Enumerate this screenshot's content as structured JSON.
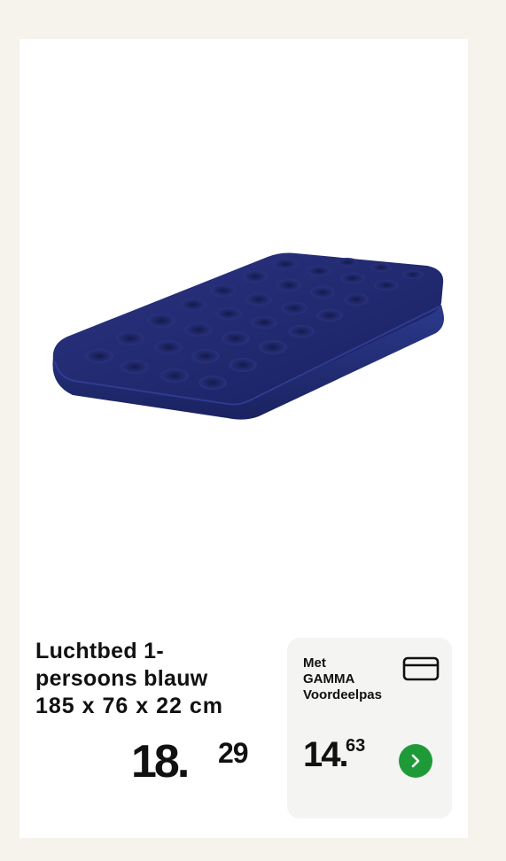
{
  "product": {
    "title_line1": "Luchtbed 1-",
    "title_line2": "persoons blauw",
    "title_line3": "185 x 76 x 22 cm",
    "image_icon": "inflatable-air-mattress",
    "mattress_color": "#1d2468"
  },
  "price": {
    "integer": "18",
    "separator": ".",
    "decimal": "29"
  },
  "promo": {
    "line1": "Met",
    "line2": "GAMMA",
    "line3": "Voordeelpas",
    "card_icon": "credit-card-icon",
    "price_integer": "14",
    "price_separator": ".",
    "price_decimal": "63",
    "button_icon": "chevron-right-icon",
    "button_color": "#1f9a38"
  }
}
